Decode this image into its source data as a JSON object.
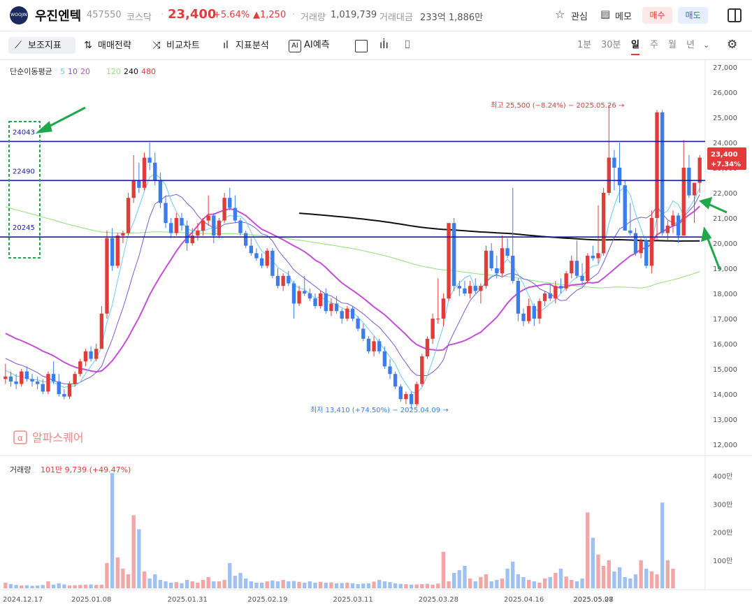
{
  "header": {
    "logo_text": "WOOJIN ENTECH",
    "name": "우진엔텍",
    "code": "457550",
    "market": "코스닥",
    "price": "23,400",
    "change_pct": "+5.64%",
    "change_abs": "▲1,250",
    "volume_label": "거래량",
    "volume_value": "1,019,739",
    "amount_label": "거래대금",
    "amount_value": "233억 1,886만",
    "watch_label": "관심",
    "memo_label": "메모",
    "buy_label": "매수",
    "sell_label": "매도"
  },
  "toolbar": {
    "items": [
      "보조지표",
      "매매전략",
      "비교차트",
      "지표분석",
      "AI예측"
    ],
    "periods": [
      "1분",
      "30분",
      "일",
      "주",
      "월",
      "년"
    ],
    "active_period": "일"
  },
  "indicator_legend": {
    "title": "단순이동평균",
    "p5": "5",
    "p10": "10",
    "p20": "20",
    "p120": "120",
    "p240": "240",
    "p480": "480"
  },
  "watermark": "알파스퀘어",
  "annotations": {
    "high": "최고 25,500 (−8.24%) − 2025.05.26 →",
    "low": "최저 13,410 (+74.50%) − 2025.04.09 →",
    "level1": "24043",
    "level2": "22490",
    "level3": "20245",
    "price_tag": "23,400",
    "price_tag_pct": "+7.34%"
  },
  "volume_legend": {
    "title": "거래량",
    "value": "101만 9,739 (+49.47%)"
  },
  "colors": {
    "up": "#e23b3b",
    "down": "#3b7ded",
    "ma5": "#6ecbea",
    "ma10": "#7a5bd6",
    "ma20": "#c44ed6",
    "ma120": "#8ee07a",
    "ma240": "#111111",
    "level_line": "#1a1aa8",
    "arrow": "#1ea84a"
  },
  "chart_data": {
    "type": "candlestick",
    "y_ticks": [
      "27,000",
      "26,000",
      "25,000",
      "24,000",
      "23,000",
      "22,000",
      "21,000",
      "20,000",
      "19,000",
      "18,000",
      "17,000",
      "16,000",
      "15,000",
      "14,000",
      "13,000",
      "12,000"
    ],
    "ylim": [
      12000,
      27000
    ],
    "volume_ticks": [
      "400만",
      "300만",
      "200만",
      "100만"
    ],
    "x_labels": [
      "2024.12.17",
      "2025.01.08",
      "2025.01.31",
      "2025.02.19",
      "2025.03.11",
      "2025.03.28",
      "2025.04.16",
      "2025.05.08",
      "2025.05.27"
    ],
    "ohlc": [
      [
        14600,
        15200,
        14400,
        14700
      ],
      [
        14700,
        14900,
        14300,
        14500
      ],
      [
        14500,
        14800,
        14200,
        14400
      ],
      [
        14400,
        15000,
        14300,
        14900
      ],
      [
        14900,
        15100,
        14500,
        14600
      ],
      [
        14600,
        14800,
        14300,
        14500
      ],
      [
        14500,
        14700,
        14200,
        14400
      ],
      [
        14400,
        14600,
        14000,
        14100
      ],
      [
        14100,
        14900,
        14000,
        14800
      ],
      [
        14800,
        15300,
        14400,
        14500
      ],
      [
        14500,
        14800,
        13900,
        14000
      ],
      [
        14000,
        14200,
        13800,
        13900
      ],
      [
        13900,
        14500,
        13800,
        14400
      ],
      [
        14400,
        14900,
        14300,
        14800
      ],
      [
        14800,
        15400,
        14700,
        15300
      ],
      [
        15300,
        15800,
        15100,
        15700
      ],
      [
        15700,
        15900,
        15300,
        15400
      ],
      [
        15400,
        16000,
        15300,
        15800
      ],
      [
        15800,
        17500,
        15800,
        17200
      ],
      [
        17200,
        20500,
        17000,
        20200
      ],
      [
        20200,
        20600,
        18900,
        19100
      ],
      [
        19100,
        20400,
        19000,
        20300
      ],
      [
        20300,
        20500,
        20000,
        20400
      ],
      [
        20400,
        22000,
        20300,
        21800
      ],
      [
        21800,
        23500,
        21600,
        22500
      ],
      [
        22500,
        23200,
        22000,
        22200
      ],
      [
        22200,
        23600,
        22100,
        23400
      ],
      [
        23400,
        24000,
        22900,
        23200
      ],
      [
        23200,
        23600,
        22300,
        22500
      ],
      [
        22500,
        22800,
        21400,
        21600
      ],
      [
        21600,
        21900,
        20600,
        20800
      ],
      [
        20800,
        21000,
        20200,
        20400
      ],
      [
        20400,
        21200,
        20300,
        21000
      ],
      [
        21000,
        21200,
        20500,
        20700
      ],
      [
        20700,
        20900,
        19700,
        20000
      ],
      [
        20000,
        20600,
        19900,
        20300
      ],
      [
        20300,
        20800,
        20100,
        20500
      ],
      [
        20500,
        21000,
        20300,
        20900
      ],
      [
        20900,
        21900,
        20700,
        21100
      ],
      [
        21100,
        21200,
        20000,
        20300
      ],
      [
        20300,
        21000,
        20200,
        20900
      ],
      [
        20900,
        22000,
        20800,
        21800
      ],
      [
        21800,
        22200,
        21300,
        21400
      ],
      [
        21400,
        21900,
        20800,
        20900
      ],
      [
        20900,
        21000,
        20300,
        20400
      ],
      [
        20400,
        20500,
        19800,
        19900
      ],
      [
        19900,
        20200,
        19500,
        19600
      ],
      [
        19600,
        19800,
        19300,
        19400
      ],
      [
        19400,
        19600,
        19000,
        19100
      ],
      [
        19100,
        19800,
        19000,
        19700
      ],
      [
        19700,
        19800,
        18600,
        18700
      ],
      [
        18700,
        19000,
        18200,
        18300
      ],
      [
        18300,
        18800,
        18100,
        18700
      ],
      [
        18700,
        18900,
        18300,
        18400
      ],
      [
        18400,
        18500,
        17000,
        17600
      ],
      [
        17600,
        18300,
        17500,
        18100
      ],
      [
        18100,
        18700,
        17900,
        18000
      ],
      [
        18000,
        18200,
        17700,
        17800
      ],
      [
        17800,
        18000,
        17400,
        17500
      ],
      [
        17500,
        18100,
        17400,
        18000
      ],
      [
        18000,
        18200,
        17200,
        17300
      ],
      [
        17300,
        17800,
        17100,
        17600
      ],
      [
        17600,
        17900,
        17200,
        17300
      ],
      [
        17300,
        17400,
        16800,
        17000
      ],
      [
        17000,
        17500,
        16900,
        17400
      ],
      [
        17400,
        17500,
        16900,
        17000
      ],
      [
        17000,
        17100,
        16500,
        16600
      ],
      [
        16600,
        16800,
        16100,
        16200
      ],
      [
        16200,
        16300,
        15600,
        15700
      ],
      [
        15700,
        16300,
        15500,
        16100
      ],
      [
        16100,
        16200,
        15600,
        15700
      ],
      [
        15700,
        15900,
        15000,
        15100
      ],
      [
        15100,
        15400,
        14600,
        14800
      ],
      [
        14800,
        14900,
        14200,
        14300
      ],
      [
        14300,
        14400,
        13700,
        13800
      ],
      [
        13800,
        14100,
        13600,
        14000
      ],
      [
        14000,
        14100,
        13410,
        13600
      ],
      [
        13600,
        14500,
        13500,
        14400
      ],
      [
        14400,
        15600,
        14300,
        15500
      ],
      [
        15500,
        16300,
        15400,
        16200
      ],
      [
        16200,
        17200,
        16000,
        17000
      ],
      [
        17000,
        18600,
        16800,
        17000
      ],
      [
        17000,
        18000,
        16700,
        17800
      ],
      [
        17800,
        20800,
        17700,
        20800
      ],
      [
        20800,
        21000,
        18100,
        18300
      ],
      [
        18300,
        18500,
        17900,
        18200
      ],
      [
        18200,
        18500,
        17900,
        18000
      ],
      [
        18000,
        18500,
        17800,
        18300
      ],
      [
        18300,
        18600,
        18000,
        18100
      ],
      [
        18100,
        18400,
        17600,
        18300
      ],
      [
        18300,
        19900,
        18200,
        19700
      ],
      [
        19700,
        20000,
        18900,
        19000
      ],
      [
        19000,
        19500,
        18600,
        18800
      ],
      [
        18800,
        20300,
        18700,
        19800
      ],
      [
        19800,
        20200,
        19400,
        19500
      ],
      [
        19500,
        22200,
        18400,
        18500
      ],
      [
        18500,
        18600,
        16900,
        17200
      ],
      [
        17200,
        17400,
        16700,
        16900
      ],
      [
        16900,
        17800,
        16800,
        17500
      ],
      [
        17500,
        17600,
        16700,
        17000
      ],
      [
        17000,
        17800,
        16800,
        17700
      ],
      [
        17700,
        18100,
        17500,
        18000
      ],
      [
        18000,
        18400,
        17700,
        17800
      ],
      [
        17800,
        18500,
        17600,
        18300
      ],
      [
        18300,
        18600,
        18000,
        18200
      ],
      [
        18200,
        18900,
        18100,
        18800
      ],
      [
        18800,
        19500,
        18600,
        19300
      ],
      [
        19300,
        20100,
        18600,
        18700
      ],
      [
        18700,
        19200,
        18300,
        18500
      ],
      [
        18500,
        19600,
        18400,
        19500
      ],
      [
        19500,
        19900,
        19300,
        19400
      ],
      [
        19400,
        21500,
        19200,
        19600
      ],
      [
        19600,
        22200,
        19500,
        22000
      ],
      [
        22000,
        25500,
        21900,
        23400
      ],
      [
        23400,
        23700,
        22100,
        23000
      ],
      [
        23000,
        24000,
        21600,
        22300
      ],
      [
        22300,
        22500,
        20500,
        20500
      ],
      [
        20500,
        21600,
        20300,
        20400
      ],
      [
        20400,
        20600,
        19500,
        19600
      ],
      [
        19600,
        20200,
        19400,
        20100
      ],
      [
        20100,
        20200,
        19000,
        19100
      ],
      [
        19100,
        21300,
        18800,
        21000
      ],
      [
        21000,
        25300,
        20100,
        25200
      ],
      [
        25200,
        25300,
        20300,
        20400
      ],
      [
        20400,
        20900,
        20100,
        20700
      ],
      [
        20700,
        21300,
        20400,
        21100
      ],
      [
        21100,
        21200,
        20000,
        20300
      ],
      [
        20300,
        24100,
        20800,
        23000
      ],
      [
        23000,
        23500,
        21800,
        21900
      ],
      [
        21900,
        22100,
        20800,
        22400
      ],
      [
        22400,
        23500,
        22000,
        23400
      ]
    ],
    "volume_scale_max": 4000000,
    "volumes": [
      200000,
      150000,
      120000,
      100000,
      110000,
      90000,
      100000,
      120000,
      250000,
      130000,
      180000,
      140000,
      100000,
      110000,
      120000,
      130000,
      140000,
      120000,
      130000,
      900000,
      4100000,
      1100000,
      700000,
      500000,
      2600000,
      2100000,
      600000,
      350000,
      500000,
      300000,
      250000,
      200000,
      220000,
      180000,
      300000,
      250000,
      200000,
      300000,
      400000,
      250000,
      250000,
      300000,
      900000,
      450000,
      550000,
      350000,
      250000,
      200000,
      200000,
      250000,
      280000,
      250000,
      300000,
      250000,
      260000,
      230000,
      200000,
      250000,
      200000,
      230000,
      200000,
      210000,
      180000,
      190000,
      200000,
      180000,
      150000,
      170000,
      180000,
      240000,
      300000,
      250000,
      220000,
      180000,
      160000,
      150000,
      130000,
      140000,
      150000,
      160000,
      130000,
      170000,
      1300000,
      250000,
      550000,
      650000,
      800000,
      350000,
      250000,
      400000,
      500000,
      250000,
      300000,
      350000,
      700000,
      950000,
      500000,
      400000,
      300000,
      250000,
      200000,
      350000,
      400000,
      550000,
      700000,
      420000,
      300000,
      250000,
      350000,
      2700000,
      1800000,
      1200000,
      800000,
      1000000,
      600000,
      750000,
      400000,
      350000,
      500000,
      1000000,
      700000,
      600000,
      500000,
      3050000,
      1000000,
      700000
    ]
  }
}
